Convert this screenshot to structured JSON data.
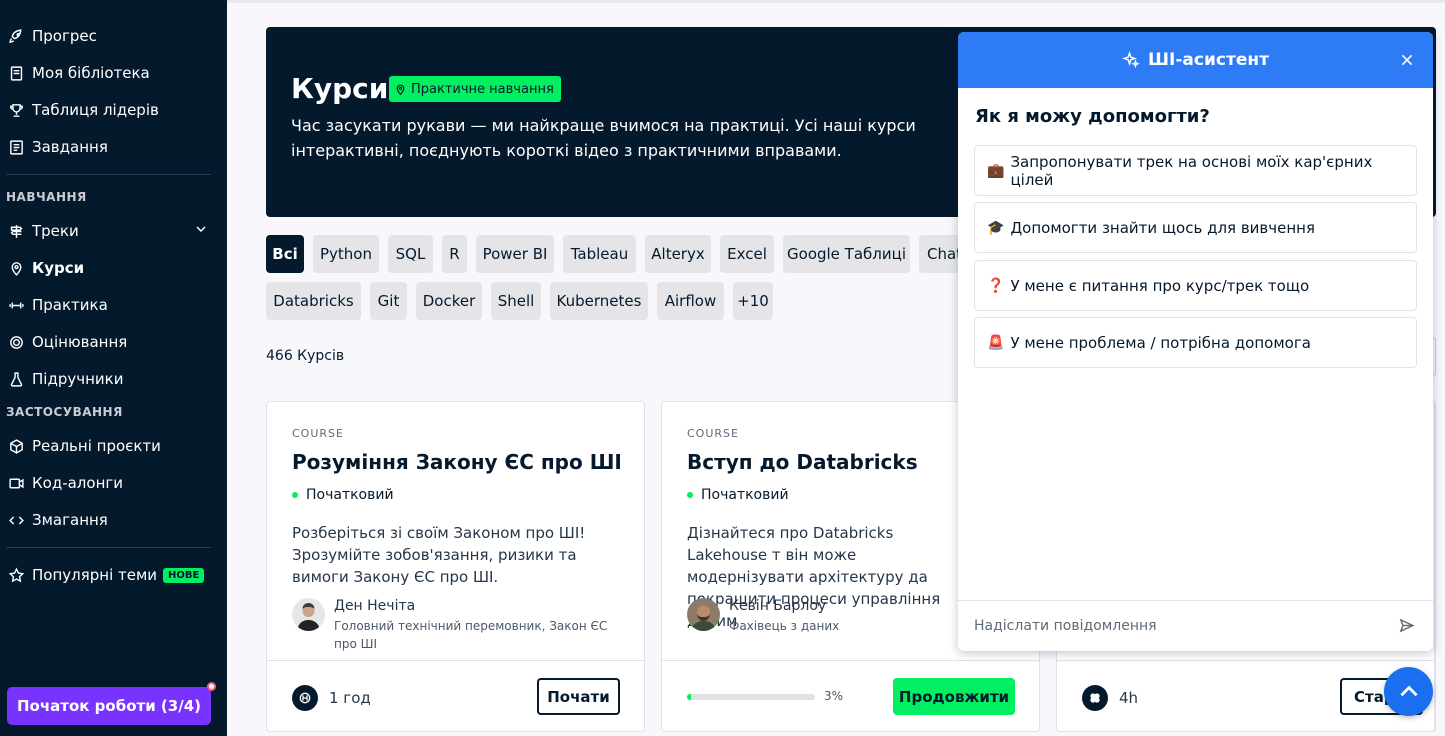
{
  "sidebar": {
    "items_top": [
      {
        "label": "Прогрес",
        "icon": "rocket-icon"
      },
      {
        "label": "Моя бібліотека",
        "icon": "book-icon"
      },
      {
        "label": "Таблиця лідерів",
        "icon": "trophy-icon"
      },
      {
        "label": "Завдання",
        "icon": "task-icon"
      }
    ],
    "section_learning": "НАВЧАННЯ",
    "items_learning": [
      {
        "label": "Треки",
        "icon": "signpost-icon"
      },
      {
        "label": "Курси",
        "icon": "pin-icon"
      },
      {
        "label": "Практика",
        "icon": "dumbbell-icon"
      },
      {
        "label": "Оцінювання",
        "icon": "target-icon"
      },
      {
        "label": "Підручники",
        "icon": "flask-icon"
      }
    ],
    "section_apply": "ЗАСТОСУВАННЯ",
    "items_apply": [
      {
        "label": "Реальні проєкти",
        "icon": "cube-icon"
      },
      {
        "label": "Код-алонги",
        "icon": "video-icon"
      },
      {
        "label": "Змагання",
        "icon": "code-icon"
      }
    ],
    "popular": {
      "label": "Популярні теми",
      "badge": "НОВЕ"
    },
    "start_button": "Початок роботи (3/4)"
  },
  "hero": {
    "title": "Курси",
    "badge": "Практичне навчання",
    "description": "Час засукати рукави — ми найкраще вчимося на практиці. Усі наші курси інтерактивні, поєднують короткі відео з практичними вправами."
  },
  "filters_row1": [
    "Всі",
    "Python",
    "SQL",
    "R",
    "Power BI",
    "Tableau",
    "Alteryx",
    "Excel",
    "Google Таблиці",
    "Chat"
  ],
  "filters_row2": [
    "Databricks",
    "Git",
    "Docker",
    "Shell",
    "Kubernetes",
    "Airflow",
    "+10"
  ],
  "count_label": "466 Курсів",
  "cards": [
    {
      "type": "COURSE",
      "title": "Розуміння Закону ЄС про ШІ",
      "level": "Початковий",
      "description": "Розберіться зі своїм Законом про ШІ! Зрозумійте зобов'язання, ризики та вимоги Закону ЄС про ШІ.",
      "author": "Ден Нечіта",
      "author_role": "Головний технічний перемовник, Закон ЄС про ШІ",
      "duration": "1 год",
      "button": "Почати"
    },
    {
      "type": "COURSE",
      "title": "Вступ до Databricks",
      "level": "Початковий",
      "description": "Дізнайтеся про Databricks Lakehouse т він може модернізувати архітектуру да покращити процеси управління даним",
      "author": "Кевін Барлоу",
      "author_role": "Фахівець з даних",
      "progress": 0.03,
      "progress_label": "3%",
      "button": "Продовжити"
    },
    {
      "duration": "4h",
      "button": "Стар"
    }
  ],
  "assistant": {
    "title": "ШІ-асистент",
    "question": "Як я можу допомогти?",
    "options": [
      {
        "emoji": "💼",
        "label": "Запропонувати трек на основі моїх кар'єрних цілей"
      },
      {
        "emoji": "🎓",
        "label": "Допомогти знайти щось для вивчення"
      },
      {
        "emoji": "❓",
        "label": "У мене є питання про курс/трек тощо"
      },
      {
        "emoji": "🚨",
        "label": "У мене проблема / потрібна допомога"
      }
    ],
    "input_placeholder": "Надіслати повідомлення"
  },
  "colors": {
    "navy": "#05192d",
    "green": "#03ef62",
    "purple": "#7933ff",
    "blue": "#2e7bf6"
  }
}
